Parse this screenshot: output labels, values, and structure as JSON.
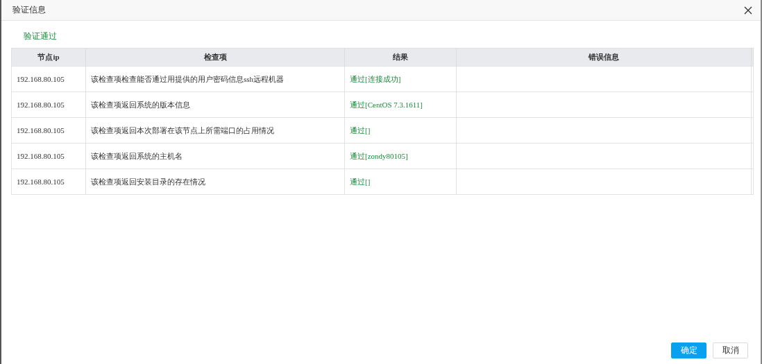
{
  "dialog": {
    "title": "验证信息"
  },
  "status": {
    "text": "验证通过",
    "passed": true
  },
  "table": {
    "columns": [
      "节点ip",
      "检查项",
      "结果",
      "错误信息"
    ],
    "rows": [
      {
        "ip": "192.168.80.105",
        "check": "该检查项检查能否通过用提供的用户密码信息ssh远程机器",
        "result": "通过[连接成功]",
        "passed": true,
        "error": ""
      },
      {
        "ip": "192.168.80.105",
        "check": "该检查项返回系统的版本信息",
        "result": "通过[CentOS 7.3.1611]",
        "passed": true,
        "error": ""
      },
      {
        "ip": "192.168.80.105",
        "check": "该检查项返回本次部署在该节点上所需端口的占用情况",
        "result": "通过[]",
        "passed": true,
        "error": ""
      },
      {
        "ip": "192.168.80.105",
        "check": "该检查项返回系统的主机名",
        "result": "通过[zondy80105]",
        "passed": true,
        "error": ""
      },
      {
        "ip": "192.168.80.105",
        "check": "该检查项返回安装目录的存在情况",
        "result": "通过[]",
        "passed": true,
        "error": ""
      }
    ]
  },
  "buttons": [
    {
      "label": "确定",
      "kind": "primary"
    },
    {
      "label": "取消",
      "kind": "default"
    }
  ]
}
